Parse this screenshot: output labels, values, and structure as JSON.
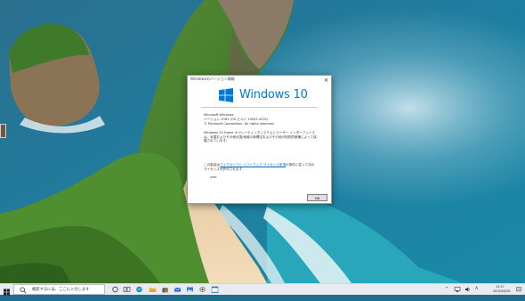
{
  "dialog": {
    "title": "Windowsのバージョン情報",
    "close_glyph": "×",
    "logo_text": "Windows 10",
    "product": "Microsoft Windows",
    "version": "バージョン 20H2 (OS ビルド 19045.4291)",
    "copyright": "© Microsoft Corporation. All rights reserved.",
    "description": "Windows 10 Home オペレーティングシステムとユーザー インターフェイスは、米国およびその他の国/地域の商標法およびその他の知的財産権によって保護されています。",
    "license_prefix": "この製品は",
    "license_link": "マイクロソフト ソフトウェア ライセンス条項",
    "license_suffix": "の条件に従って次の",
    "license_line2": "ライセンスが許可されます:",
    "licensed_user": "user",
    "ok_label": "OK"
  },
  "taskbar": {
    "search_placeholder": "検索するには、ここに入力します",
    "clock_time": "13:17",
    "clock_date": "2024/04/30",
    "ime_label": "A",
    "apps": [
      "cortana-icon",
      "task-view-icon",
      "edge-icon",
      "explorer-icon",
      "store-icon",
      "mail-icon",
      "photos-icon",
      "settings-icon",
      "winver-icon"
    ],
    "tray": [
      "chevron-up-icon",
      "network-icon",
      "volume-icon",
      "ime-icon"
    ]
  },
  "colors": {
    "accent": "#0078d7",
    "link": "#0066cc",
    "taskbar": "#e8ecf0",
    "sea": "#1b6f8c",
    "cliff": "#4d8a2e"
  }
}
